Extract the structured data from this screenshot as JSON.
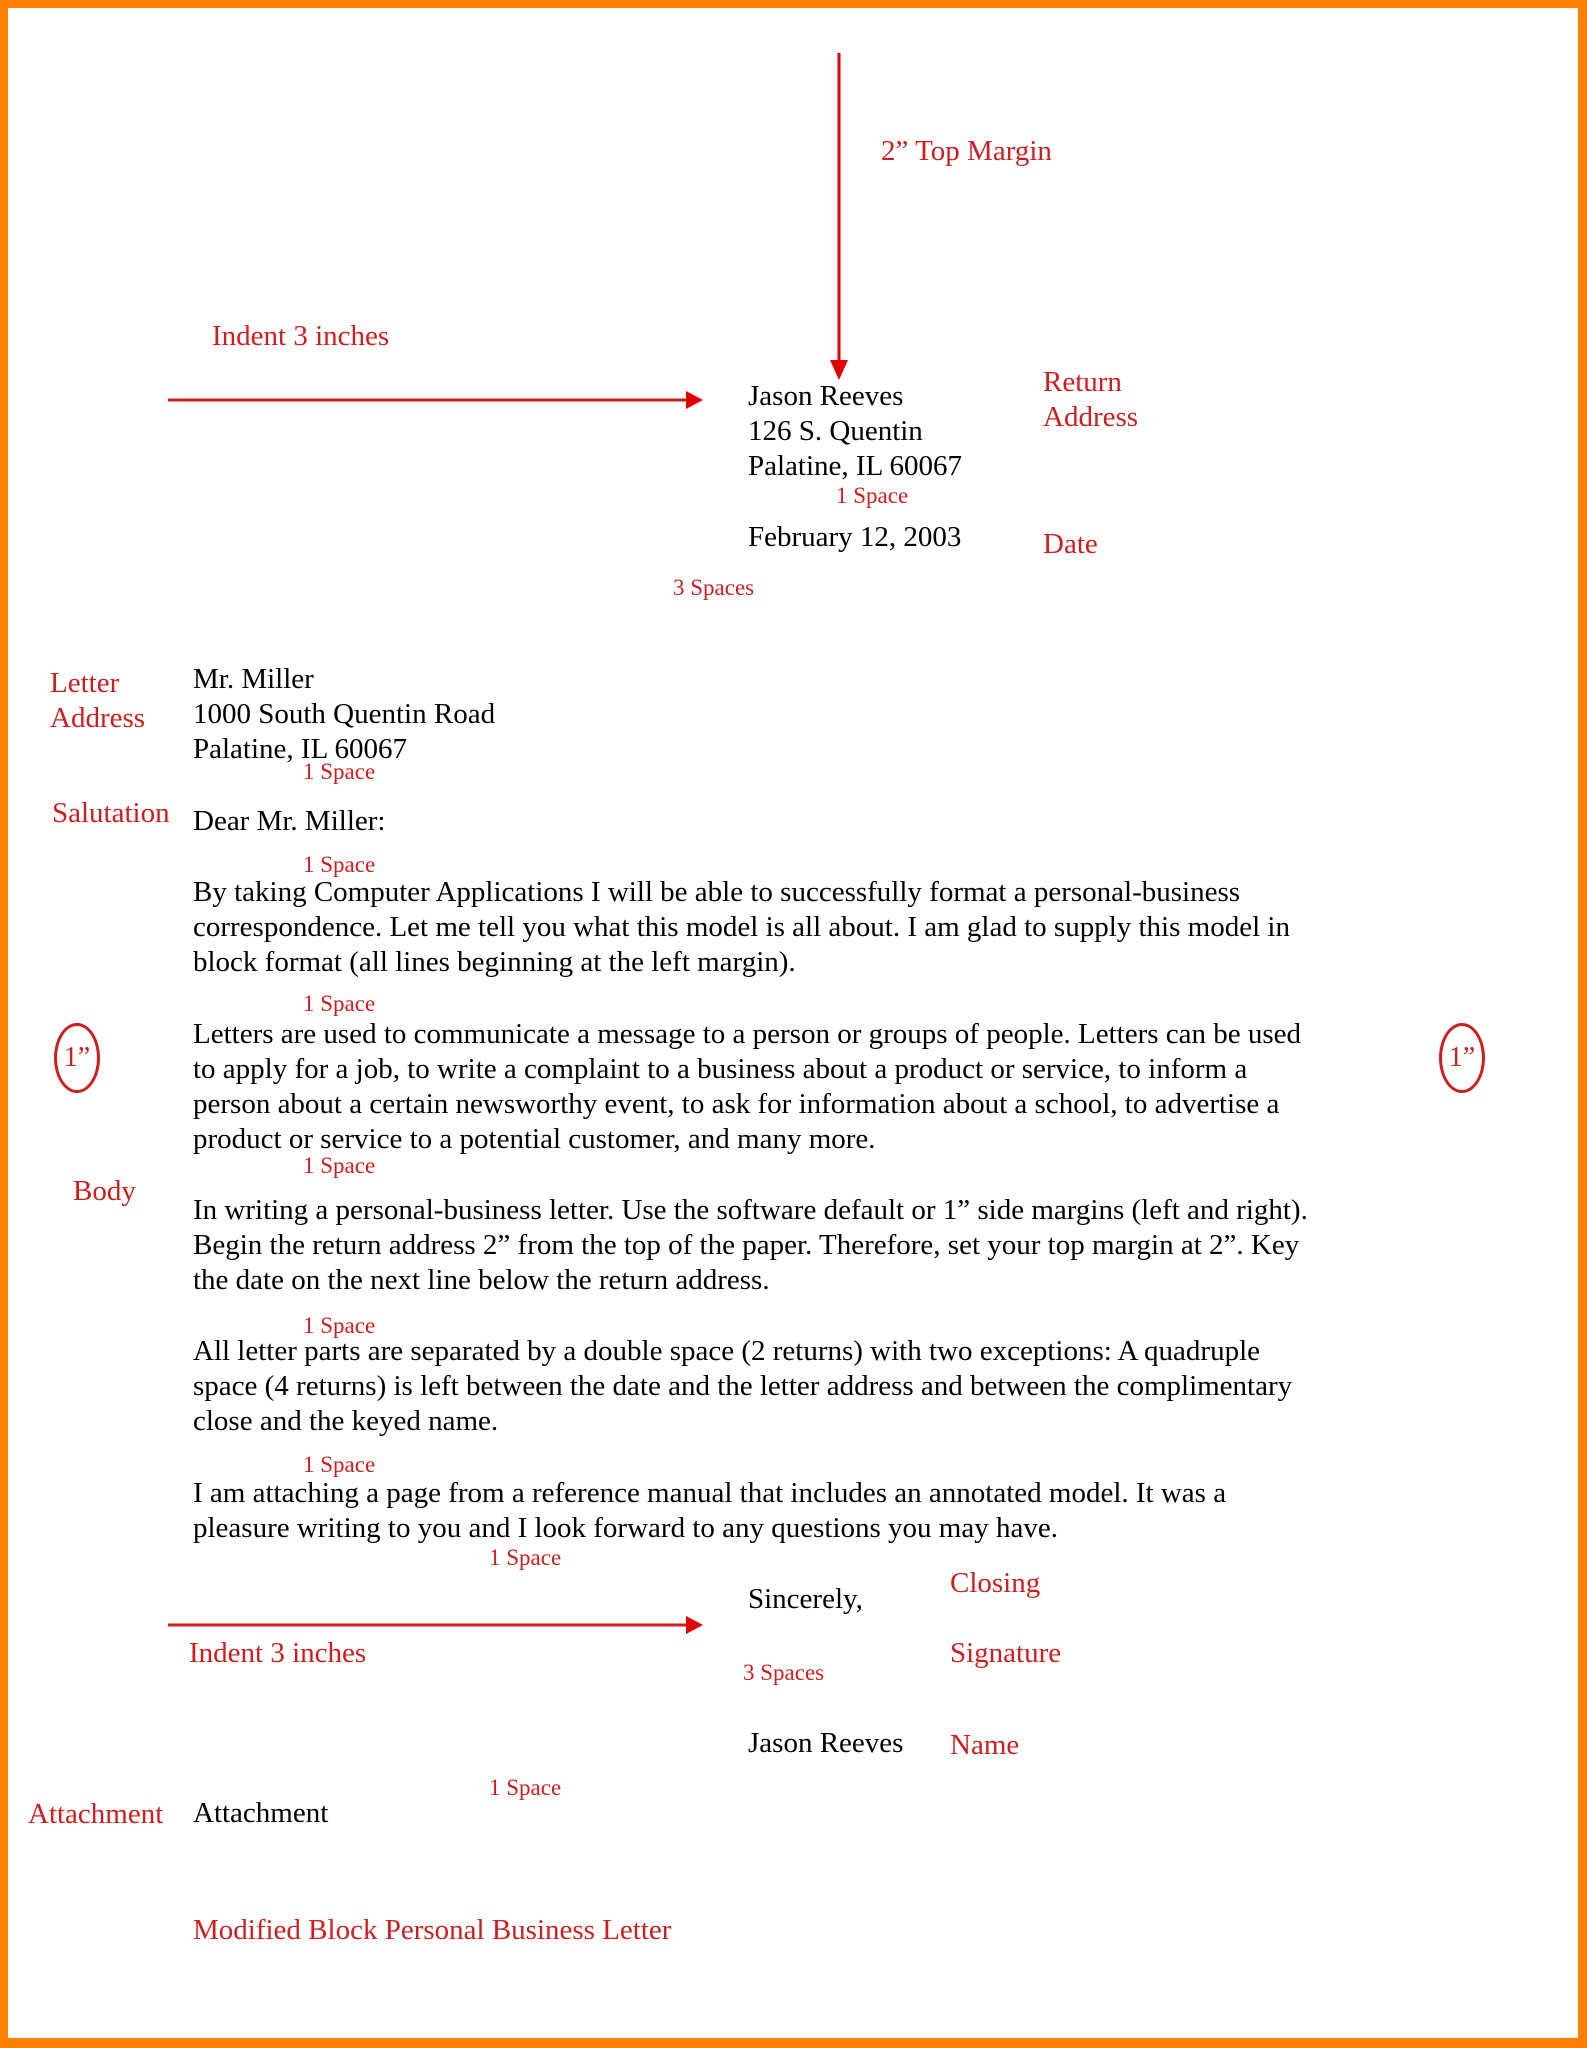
{
  "colors": {
    "border": "#ff8000",
    "annotation": "#cc1f1f",
    "text": "#000000"
  },
  "annotations": {
    "top_margin": "2” Top Margin",
    "indent_top": "Indent 3 inches",
    "return_address": [
      "Return",
      "Address"
    ],
    "date": "Date",
    "space_after_return": "1 Space",
    "spaces_after_date": "3 Spaces",
    "letter_address": [
      "Letter",
      "Address"
    ],
    "space_after_letter_address": "1 Space",
    "salutation": "Salutation",
    "space_after_salutation": "1 Space",
    "space_after_p1": "1 Space",
    "margin_left": "1”",
    "margin_right": "1”",
    "body": "Body",
    "space_after_p2": "1 Space",
    "space_after_p3": "1 Space",
    "space_after_p4": "1 Space",
    "space_after_p5": "1 Space",
    "closing": "Closing",
    "indent_bottom": "Indent 3 inches",
    "signature": "Signature",
    "spaces_after_closing": "3 Spaces",
    "name": "Name",
    "space_after_name": "1 Space",
    "attachment": "Attachment",
    "caption": "Modified Block Personal Business Letter"
  },
  "letter": {
    "return_address": [
      "Jason Reeves",
      "126 S. Quentin",
      "Palatine, IL  60067"
    ],
    "date": "February 12, 2003",
    "letter_address": [
      "Mr. Miller",
      "1000 South Quentin Road",
      "Palatine, IL  60067"
    ],
    "salutation": "Dear Mr. Miller:",
    "paragraphs": [
      [
        "By taking Computer Applications I will be able to successfully format a personal-business",
        "correspondence.  Let me tell you what this model is all about.  I am glad to supply this model in",
        "block format (all lines beginning at the left margin)."
      ],
      [
        "Letters are used to communicate a message to a person or groups of people.  Letters can be used",
        "to apply for a job, to write a complaint to a business about a product or service, to inform a",
        "person about a certain newsworthy event, to ask for information about a school, to advertise a",
        "product or service to a potential customer, and many more."
      ],
      [
        "In writing a personal-business letter.  Use the software default or 1” side margins (left and right).",
        "Begin the return address 2” from the top of the paper.  Therefore, set your top margin at 2”.  Key",
        "the date on the next line below the return address."
      ],
      [
        "All letter parts are separated by a double space (2 returns) with two exceptions:  A quadruple",
        "space (4 returns) is left between the date and the letter address and between the complimentary",
        "close and the keyed name."
      ],
      [
        "I am attaching a page from a reference manual that includes an annotated model.  It was a",
        "pleasure writing to you and I look forward to any questions you may have."
      ]
    ],
    "closing": "Sincerely,",
    "name": "Jason Reeves",
    "attachment": "Attachment"
  }
}
